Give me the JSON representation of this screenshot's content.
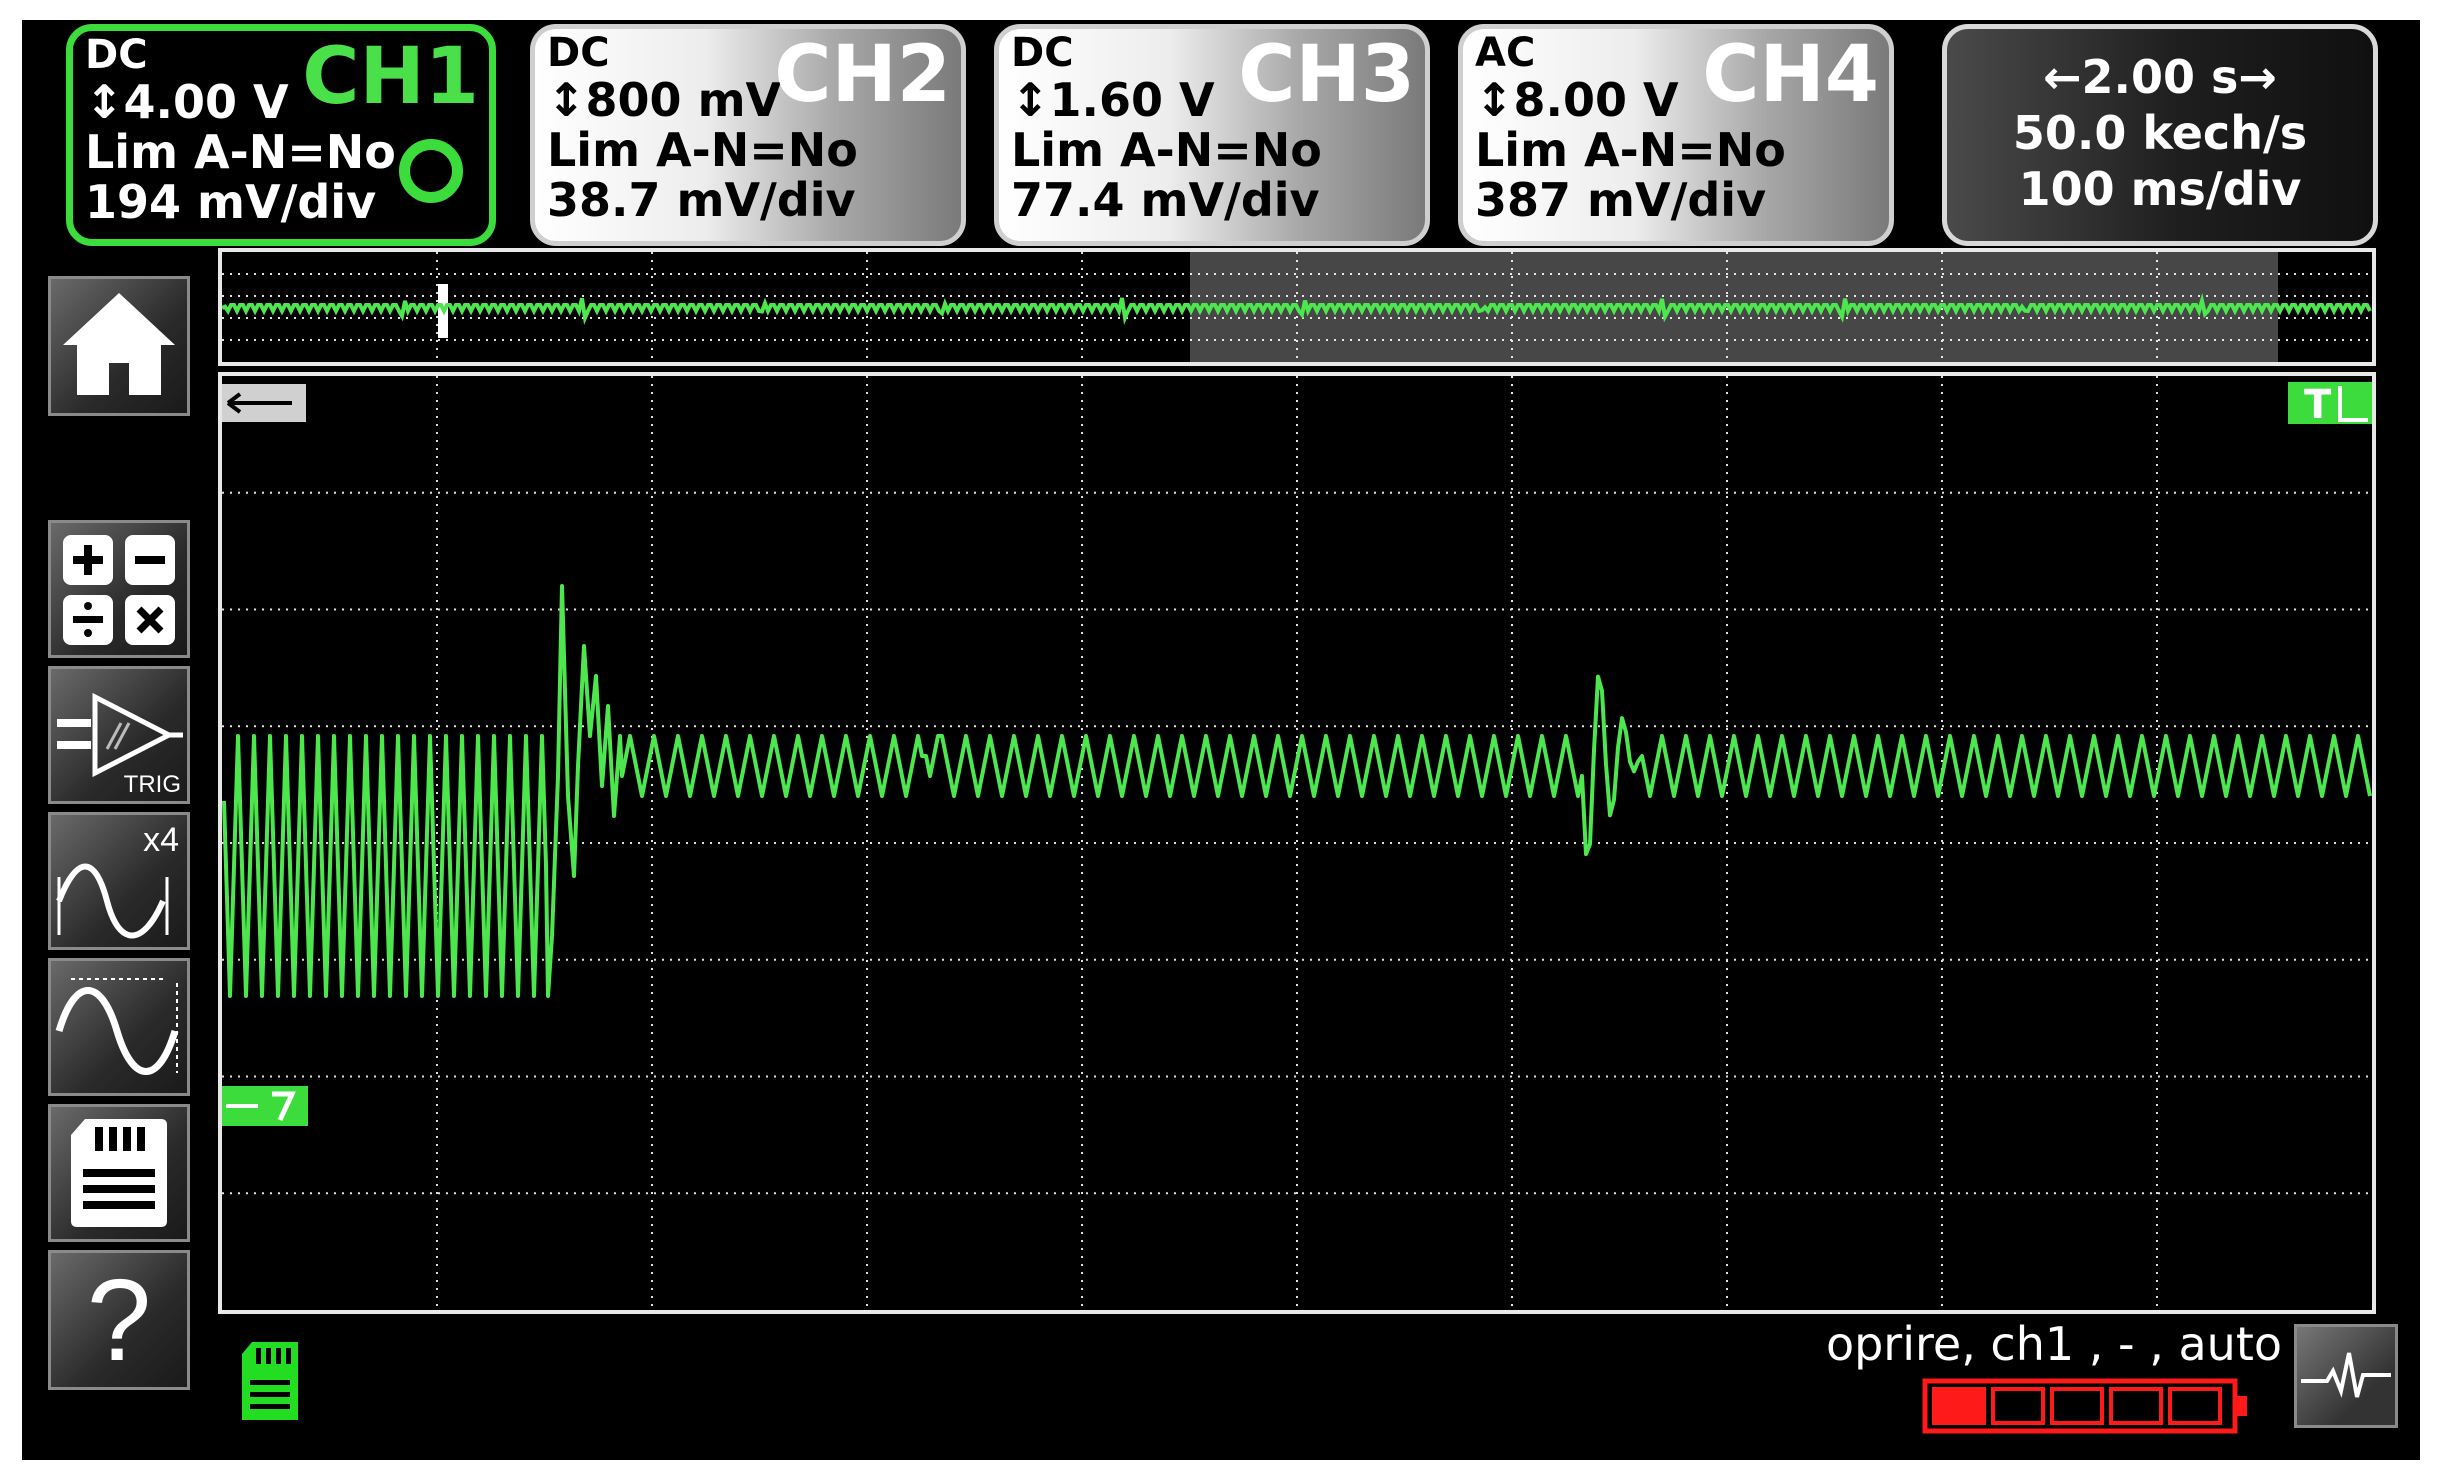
{
  "channels": [
    {
      "coupling": "DC",
      "sensitivity": "↕4.00 V",
      "limit": "Lim A-N=No",
      "scale": "194 mV/div",
      "name": "CH1"
    },
    {
      "coupling": "DC",
      "sensitivity": "↕800 mV",
      "limit": "Lim A-N=No",
      "scale": "38.7 mV/div",
      "name": "CH2"
    },
    {
      "coupling": "DC",
      "sensitivity": "↕1.60 V",
      "limit": "Lim A-N=No",
      "scale": "77.4 mV/div",
      "name": "CH3"
    },
    {
      "coupling": "AC",
      "sensitivity": "↕8.00 V",
      "limit": "Lim A-N=No",
      "scale": "387 mV/div",
      "name": "CH4"
    }
  ],
  "timebase": {
    "span": "←2.00 s→",
    "rate": "50.0 kech/s",
    "scale": "100 ms/div"
  },
  "toolbar": {
    "trig_label": "TRIG",
    "zoom_label": "x4",
    "help_label": "?"
  },
  "markers": {
    "trigger_time": "T"
  },
  "status": {
    "text": "oprire, ch1 , - , auto",
    "battery_level": 0.2
  },
  "colors": {
    "trace": "#4ee64e",
    "active": "#3cdc3c",
    "battery": "#ff1a1a"
  }
}
